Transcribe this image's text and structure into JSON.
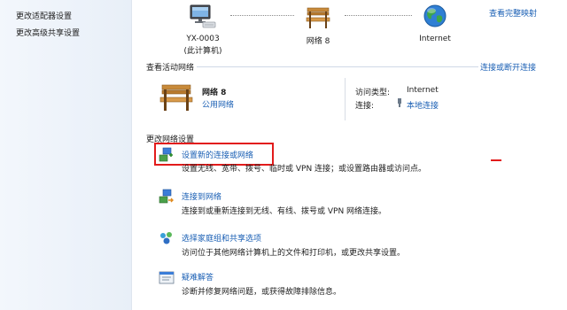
{
  "sidebar": {
    "items": [
      {
        "label": "更改适配器设置"
      },
      {
        "label": "更改高级共享设置"
      }
    ]
  },
  "map": {
    "full_map_link": "查看完整映射",
    "nodes": [
      {
        "label": "YX-0003",
        "sublabel": "(此计算机)",
        "icon": "computer-icon"
      },
      {
        "label": "网络  8",
        "icon": "bench-icon"
      },
      {
        "label": "Internet",
        "icon": "globe-icon"
      }
    ]
  },
  "active": {
    "section_title": "查看活动网络",
    "connect_link": "连接或断开连接",
    "network_name": "网络  8",
    "network_type": "公用网络",
    "access_type_label": "访问类型:",
    "access_type_value": "Internet",
    "connection_label": "连接:",
    "connection_value": "本地连接"
  },
  "settings": {
    "section_title": "更改网络设置",
    "tasks": [
      {
        "title": "设置新的连接或网络",
        "desc": "设置无线、宽带、拨号、临时或 VPN 连接；或设置路由器或访问点。",
        "icon": "new-connection-icon"
      },
      {
        "title": "连接到网络",
        "desc": "连接到或重新连接到无线、有线、拨号或 VPN 网络连接。",
        "icon": "connect-network-icon"
      },
      {
        "title": "选择家庭组和共享选项",
        "desc": "访问位于其他网络计算机上的文件和打印机，或更改共享设置。",
        "icon": "homegroup-icon"
      },
      {
        "title": "疑难解答",
        "desc": "诊断并修复网络问题，或获得故障排除信息。",
        "icon": "troubleshoot-icon"
      }
    ]
  },
  "colors": {
    "link": "#1a5fb4",
    "highlight": "#e21b1b"
  }
}
